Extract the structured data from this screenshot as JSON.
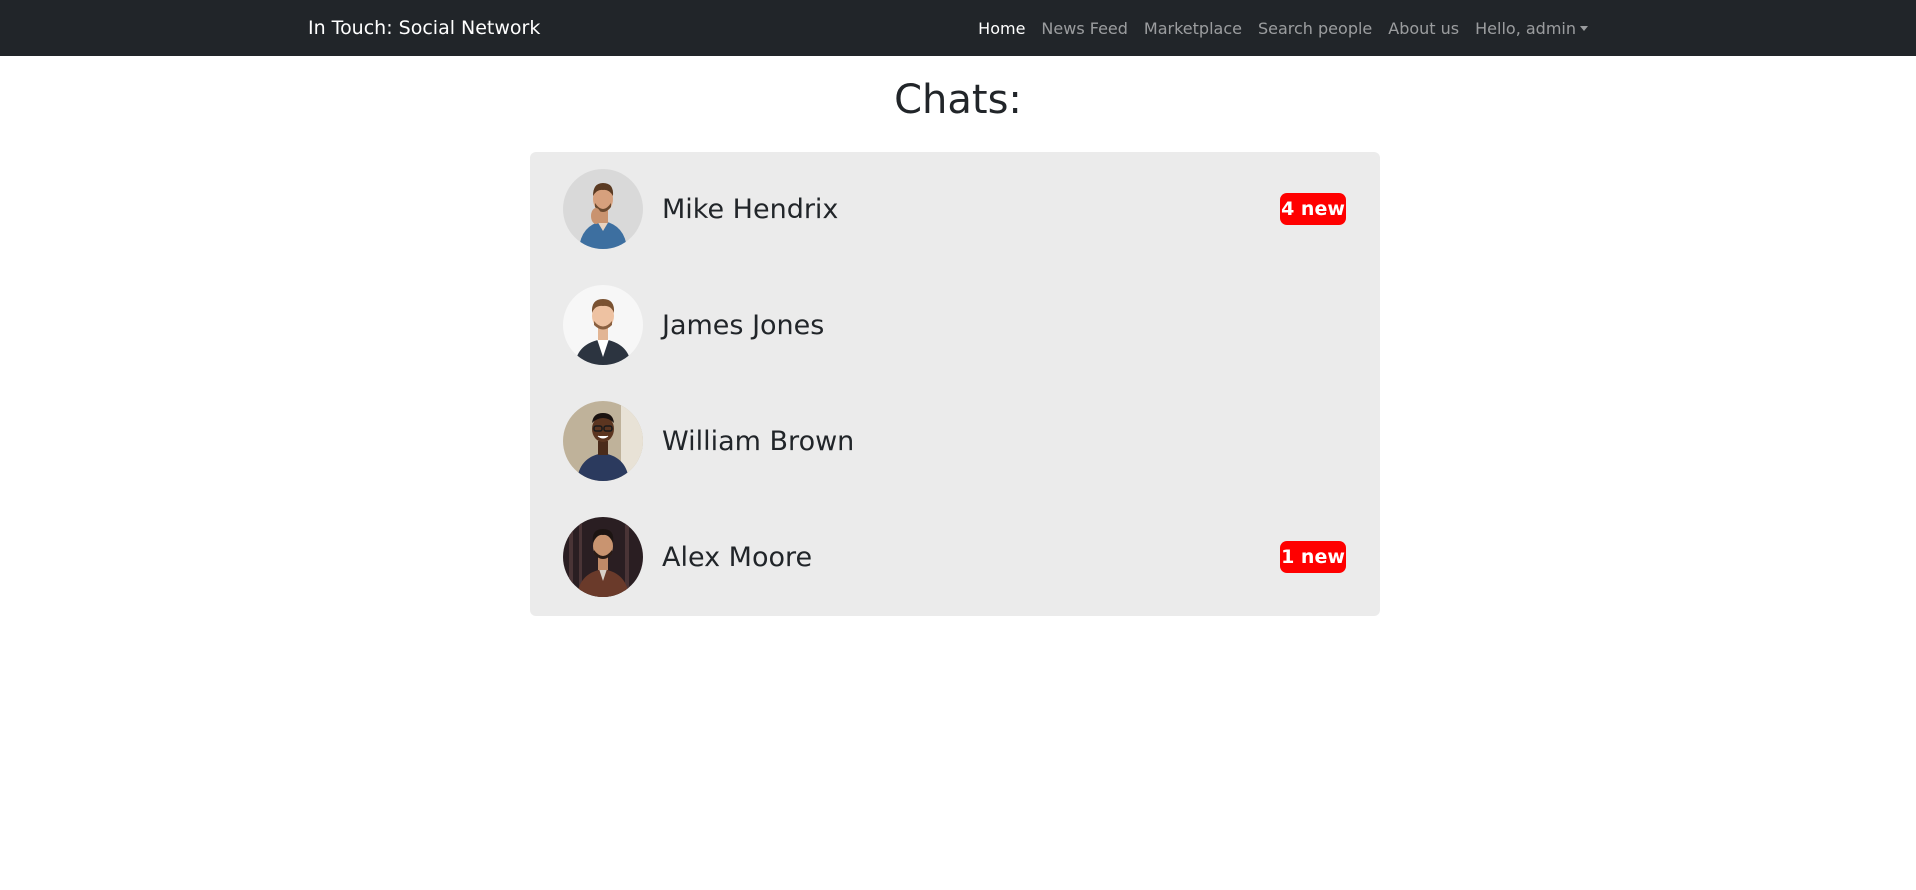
{
  "navbar": {
    "brand": "In Touch: Social Network",
    "links": [
      {
        "label": "Home",
        "active": true
      },
      {
        "label": "News Feed"
      },
      {
        "label": "Marketplace"
      },
      {
        "label": "Search people"
      },
      {
        "label": "About us"
      }
    ],
    "user_menu": "Hello, admin"
  },
  "page": {
    "title": "Chats:"
  },
  "chats": [
    {
      "name": "Mike Hendrix",
      "badge": "4 new"
    },
    {
      "name": "James Jones",
      "badge": ""
    },
    {
      "name": "William Brown",
      "badge": ""
    },
    {
      "name": "Alex Moore",
      "badge": "1 new"
    }
  ],
  "colors": {
    "navbar_bg": "#212529",
    "list_bg": "#ebebeb",
    "badge_bg": "#ff0000"
  }
}
